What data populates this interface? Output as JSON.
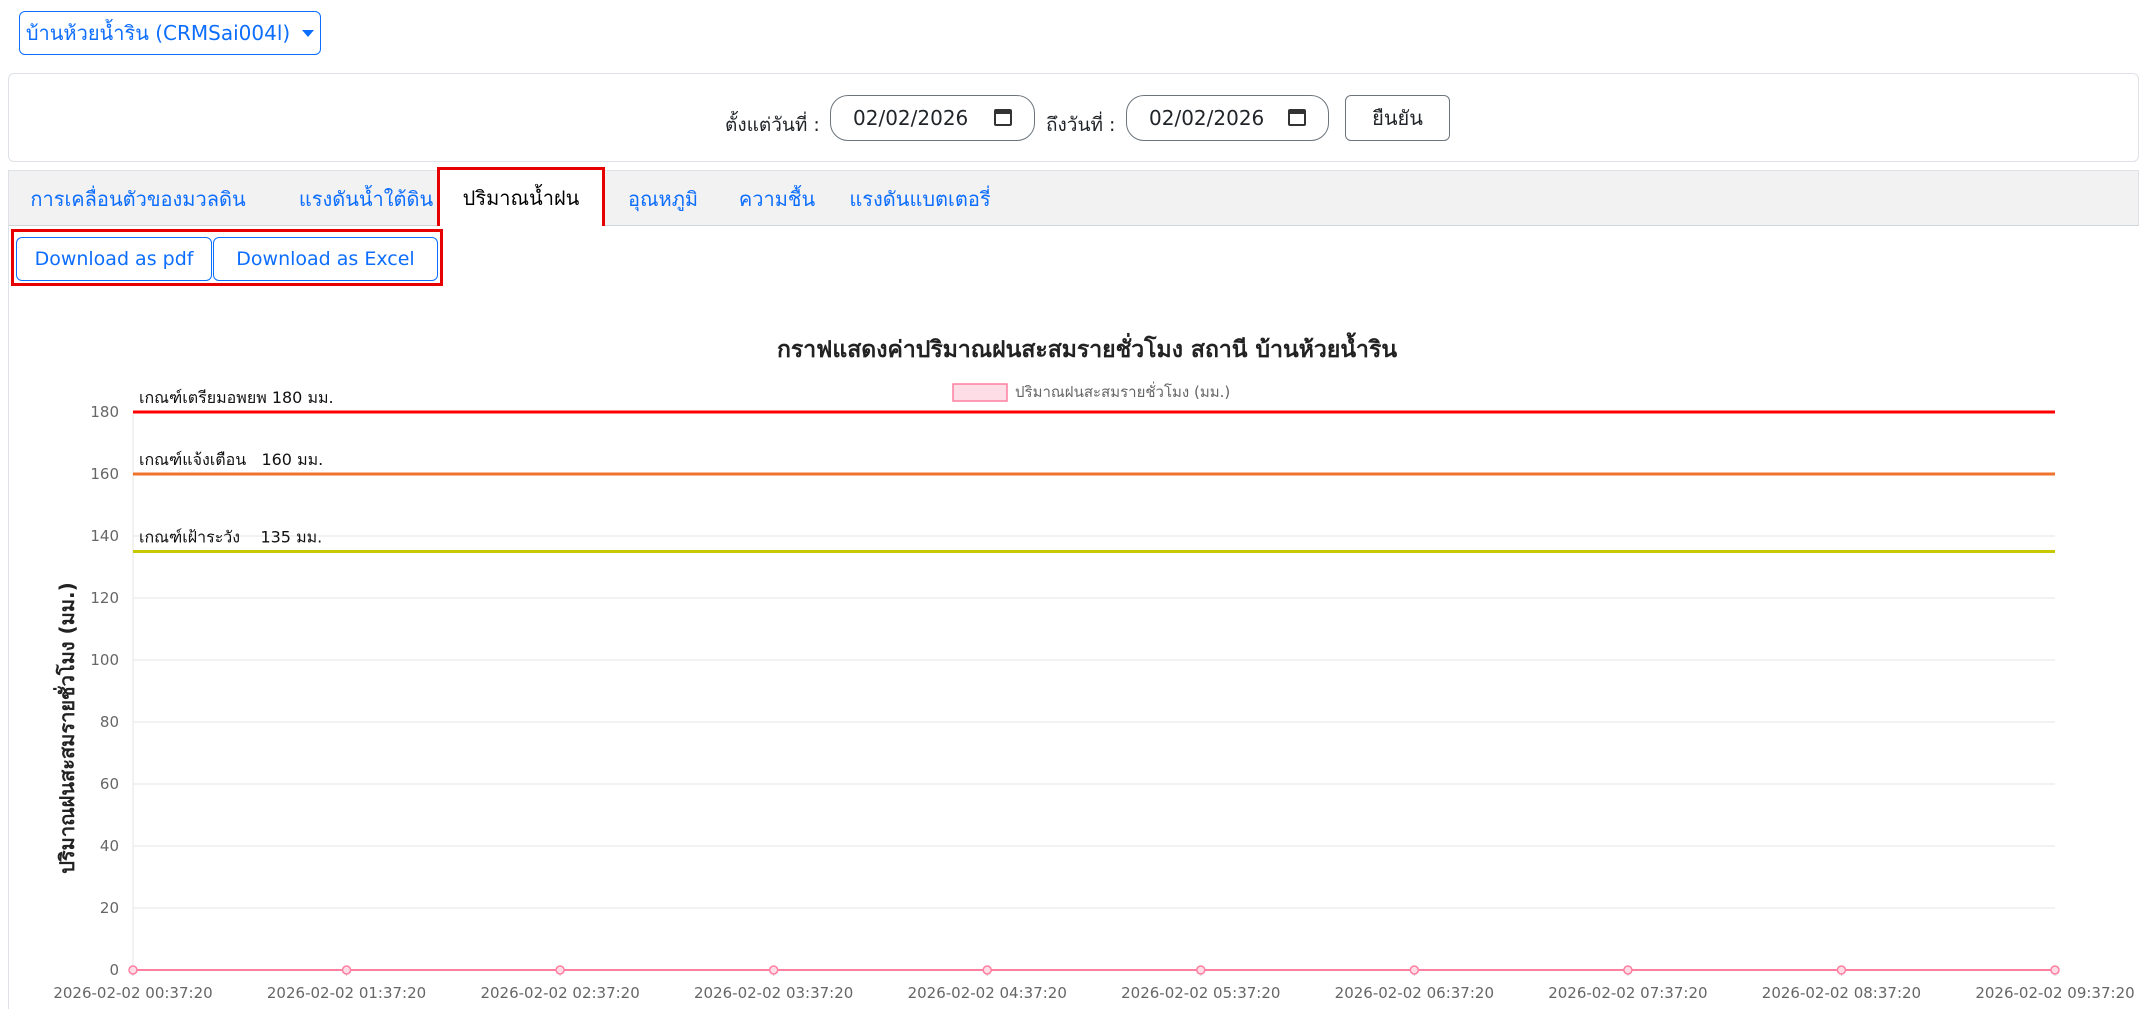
{
  "station": {
    "label": "บ้านห้วยน้ำริน (CRMSai004l)"
  },
  "date_filter": {
    "from_label": "ตั้งแต่วันที่ :",
    "from_value": "02/02/2026",
    "to_label": "ถึงวันที่ :",
    "to_value": "02/02/2026",
    "confirm_label": "ยืนยัน"
  },
  "tabs": [
    {
      "label": "การเคลื่อนตัวของมวลดิน"
    },
    {
      "label": "แรงดันน้ำใต้ดิน"
    },
    {
      "label": "ปริมาณน้ำฝน",
      "active": true
    },
    {
      "label": "อุณหภูมิ"
    },
    {
      "label": "ความชื้น"
    },
    {
      "label": "แรงดันแบตเตอรี่"
    }
  ],
  "downloads": {
    "pdf_label": "Download as pdf",
    "excel_label": "Download as Excel"
  },
  "colors": {
    "accent": "#0d6efd",
    "highlight": "#e60000",
    "threshold_red": "#ff0000",
    "threshold_orange": "#f0732d",
    "threshold_yellow": "#c8c800",
    "series_pink": "#ff7fa0"
  },
  "chart_data": {
    "type": "line",
    "title": "กราฟแสดงค่าปริมาณฝนสะสมรายชั่วโมง สถานี บ้านห้วยน้ำริน",
    "ylabel": "ปริมาณฝนสะสมรายชั่วโมง (มม.)",
    "xlabel": "",
    "legend": {
      "position": "top-center",
      "entries": [
        "ปริมาณฝนสะสมรายชั่วโมง (มม.)"
      ]
    },
    "ylim": [
      0,
      180
    ],
    "yticks": [
      0,
      20,
      40,
      60,
      80,
      100,
      120,
      140,
      160,
      180
    ],
    "grid": true,
    "x": [
      "2026-02-02 00:37:20",
      "2026-02-02 01:37:20",
      "2026-02-02 02:37:20",
      "2026-02-02 03:37:20",
      "2026-02-02 04:37:20",
      "2026-02-02 05:37:20",
      "2026-02-02 06:37:20",
      "2026-02-02 07:37:20",
      "2026-02-02 08:37:20",
      "2026-02-02 09:37:20"
    ],
    "series": [
      {
        "name": "ปริมาณฝนสะสมรายชั่วโมง (มม.)",
        "values": [
          0,
          0,
          0,
          0,
          0,
          0,
          0,
          0,
          0,
          0
        ]
      }
    ],
    "thresholds": [
      {
        "label": "เกณฑ์เตรียมอพยพ 180 มม.",
        "value": 180,
        "color": "#ff0000"
      },
      {
        "label": "เกณฑ์แจ้งเตือน   160 มม.",
        "value": 160,
        "color": "#f0732d"
      },
      {
        "label": "เกณฑ์เฝ้าระวัง    135 มม.",
        "value": 135,
        "color": "#c8c800"
      }
    ]
  }
}
